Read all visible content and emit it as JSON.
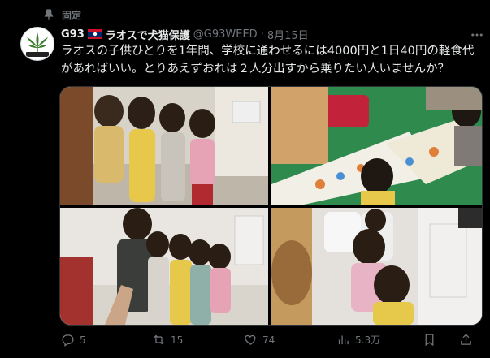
{
  "pinned": {
    "label": "固定"
  },
  "author": {
    "name": "G93",
    "name_suffix": "ラオスで犬猫保護",
    "handle": "@G93WEED",
    "separator": "·",
    "date": "8月15日",
    "flag": "laos-flag"
  },
  "tweet": {
    "lines": [
      "ラオスの子供ひとりを1年間、学校に通わせるには4000円と1日40円の軽食代",
      "があればいい。とりあえずおれは２人分出すから乗りたい人いませんか？"
    ]
  },
  "media": {
    "photos": [
      "children-group-photo",
      "children-coloring-photo",
      "children-peace-sign-photo",
      "children-indoor-photo"
    ]
  },
  "actions": {
    "replies": "5",
    "retweets": "15",
    "likes": "74",
    "views": "5.3万"
  },
  "colors": {
    "background": "#000000",
    "text": "#e7e9ea",
    "muted": "#71767b",
    "border": "#2f3336"
  }
}
